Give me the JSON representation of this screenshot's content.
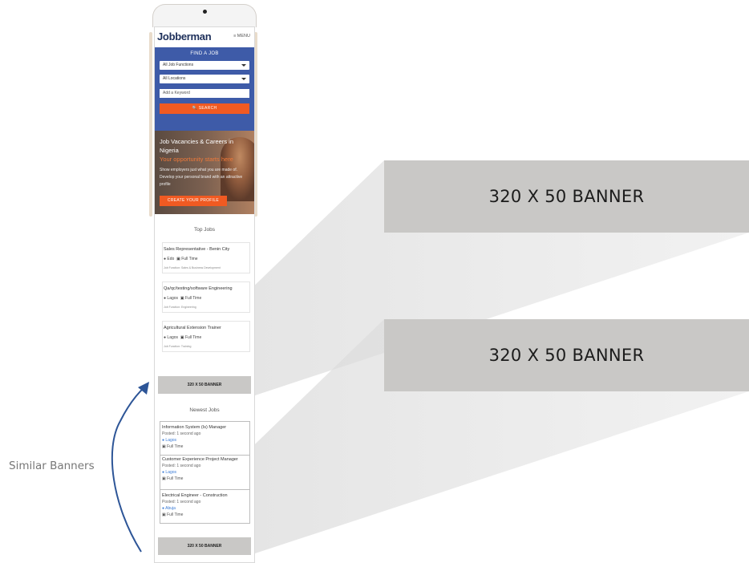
{
  "phone": {
    "logo": "Jobberman",
    "menu_label": "≡ MENU",
    "find_job": {
      "title": "FIND A JOB",
      "job_functions": "All Job Functions",
      "locations": "All Locations",
      "keyword_placeholder": "Add a Keyword",
      "search_button": "🔍 SEARCH"
    },
    "hero": {
      "heading": "Job Vacancies & Careers in Nigeria",
      "subheading": "Your opportunity starts here",
      "text": "Show employers just what you are made of. Develop your personal brand with an attractive profile",
      "button": "CREATE YOUR PROFILE"
    },
    "top_jobs": {
      "title": "Top Jobs",
      "items": [
        {
          "title": "Sales Representative - Benin City",
          "location": "Edo",
          "type": "Full Time",
          "tags": "Job Function: Sales & Business Development"
        },
        {
          "title": "Qa/qc/testing/software Engineering",
          "location": "Lagos",
          "type": "Full Time",
          "tags": "Job Function: Engineering"
        },
        {
          "title": "Agricultural Extension Trainer",
          "location": "Lagos",
          "type": "Full Time",
          "tags": "Job Function: Training"
        }
      ]
    },
    "banner_1": "320 X 50 BANNER",
    "newest_jobs": {
      "title": "Newest Jobs",
      "items": [
        {
          "title": "Information System (Is) Manager",
          "posted": "Posted: 1 second ago",
          "location": "Lagos",
          "type": "Full Time"
        },
        {
          "title": "Customer Experience Project Manager",
          "posted": "Posted: 1 second ago",
          "location": "Lagos",
          "type": "Full Time"
        },
        {
          "title": "Electrical Engineer - Construction",
          "posted": "Posted: 1 second ago",
          "location": "Abuja",
          "type": "Full Time"
        }
      ]
    },
    "banner_2": "320 X 50 BANNER"
  },
  "callouts": {
    "banner_top": "320 X 50 BANNER",
    "banner_bottom": "320 X 50 BANNER",
    "side_label": "Similar Banners"
  },
  "colors": {
    "brand_blue": "#3e5ba8",
    "accent_orange": "#f05a22",
    "banner_grey": "#c9c8c6",
    "arrow_blue": "#2d5597"
  }
}
